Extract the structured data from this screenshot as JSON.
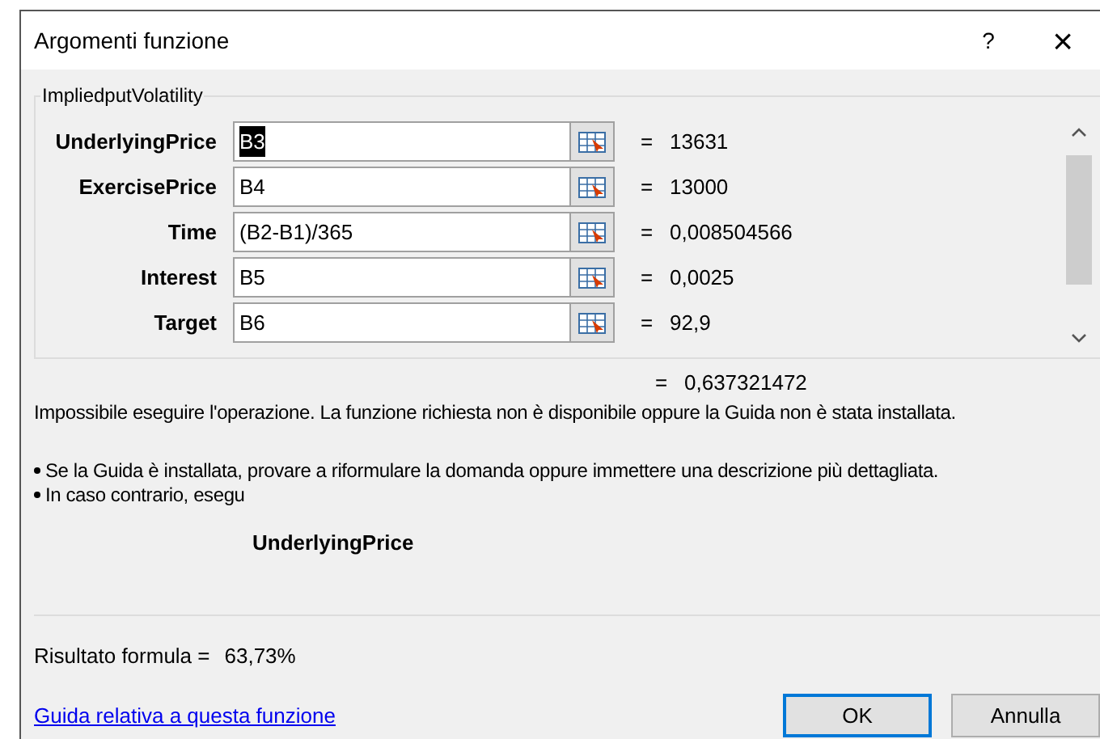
{
  "window": {
    "title": "Argomenti funzione",
    "help_button": "?",
    "close_button": "×"
  },
  "function": {
    "name": "ImpliedputVolatility",
    "arguments": [
      {
        "label": "UnderlyingPrice",
        "value": "B3",
        "text_selected": true,
        "result": "13631"
      },
      {
        "label": "ExercisePrice",
        "value": "B4",
        "text_selected": false,
        "result": "13000"
      },
      {
        "label": "Time",
        "value": "(B2-B1)/365",
        "text_selected": false,
        "result": "0,008504566"
      },
      {
        "label": "Interest",
        "value": "B5",
        "text_selected": false,
        "result": "0,0025"
      },
      {
        "label": "Target",
        "value": "B6",
        "text_selected": false,
        "result": "92,9"
      }
    ]
  },
  "equals": "=",
  "function_result": "0,637321472",
  "description": "Impossibile eseguire l'operazione.  La funzione richiesta non è disponibile oppure la Guida non è stata installata.",
  "bullets": [
    "Se la Guida è installata, provare a riformulare la domanda oppure immettere una descrizione più dettagliata.",
    "In caso contrario, esegu"
  ],
  "argument_name": "UnderlyingPrice",
  "formula_result_label": "Risultato formula =",
  "formula_result": "63,73%",
  "help_link": "Guida relativa a questa funzione",
  "buttons": [
    {
      "label": "OK",
      "default": true
    },
    {
      "label": "Annulla",
      "default": false
    }
  ]
}
